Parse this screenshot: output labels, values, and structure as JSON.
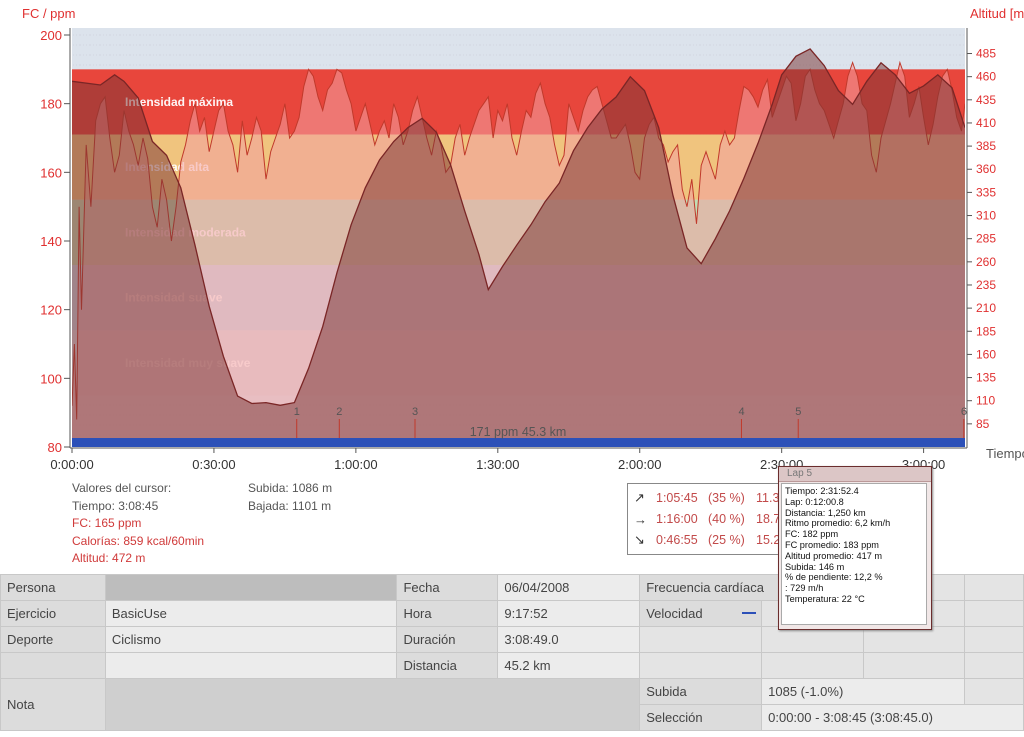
{
  "chart_data": {
    "type": "area",
    "left_axis_label": "FC / ppm",
    "right_axis_label": "Altitud [m]",
    "x_axis_label": "Tiempo",
    "ylim_fc": [
      80,
      200
    ],
    "yticks_fc": [
      "200",
      "180",
      "160",
      "140",
      "120",
      "100",
      "80"
    ],
    "ylim_alt": [
      60,
      505
    ],
    "yticks_alt": [
      "485",
      "460",
      "435",
      "410",
      "385",
      "360",
      "335",
      "310",
      "285",
      "260",
      "235",
      "210",
      "185",
      "160",
      "135",
      "110",
      "85"
    ],
    "xticks": [
      "0:00:00",
      "0:30:00",
      "1:00:00",
      "1:30:00",
      "2:00:00",
      "2:30:00",
      "3:00:00"
    ],
    "x_range_minutes": [
      0,
      188.75
    ],
    "zones": [
      {
        "name": "Intensidad máxima",
        "from": 171,
        "to": 190,
        "color": "#e8463c"
      },
      {
        "name": "Intensidad alta",
        "from": 152,
        "to": 171,
        "color": "#f0c47e"
      },
      {
        "name": "Intensidad moderada",
        "from": 133,
        "to": 152,
        "color": "#c2deb5"
      },
      {
        "name": "Intensidad suave",
        "from": 114,
        "to": 133,
        "color": "#c9d9e6"
      },
      {
        "name": "Intensidad muy suave",
        "from": 95,
        "to": 114,
        "color": "#dbdbe3"
      }
    ],
    "laps": [
      "1",
      "2",
      "3",
      "4",
      "5",
      "6"
    ],
    "lap_times_min": [
      47.5,
      56.5,
      72.5,
      141.5,
      153.5,
      188.5
    ],
    "bottom_label": "171 ppm 45.3 km",
    "altitude_series": {
      "name": "Altitud",
      "t": [
        0,
        3,
        6,
        9,
        11,
        14,
        17,
        20,
        23,
        26,
        29,
        32,
        35,
        38,
        41,
        44,
        47,
        50,
        53,
        56,
        59,
        62,
        65,
        68,
        71,
        74,
        77,
        80,
        83,
        86,
        88,
        91,
        94,
        97,
        100,
        103,
        106,
        109,
        112,
        115,
        118,
        121,
        124,
        127,
        130,
        133,
        136,
        139,
        142,
        145,
        148,
        150,
        153,
        156,
        159,
        162,
        165,
        168,
        171,
        174,
        177,
        180,
        183,
        186,
        188.75
      ],
      "values": [
        455,
        453,
        451,
        462,
        455,
        437,
        390,
        375,
        340,
        278,
        212,
        158,
        115,
        107,
        108,
        105,
        108,
        145,
        190,
        248,
        300,
        340,
        370,
        390,
        405,
        415,
        400,
        365,
        315,
        268,
        230,
        255,
        278,
        300,
        325,
        345,
        380,
        405,
        425,
        438,
        460,
        445,
        405,
        332,
        275,
        258,
        285,
        315,
        350,
        388,
        430,
        462,
        482,
        490,
        472,
        445,
        430,
        455,
        475,
        462,
        442,
        450,
        462,
        448,
        405
      ]
    },
    "heart_rate_series": {
      "name": "FC",
      "t": [
        0,
        0.5,
        1,
        1.5,
        2,
        3,
        4,
        5,
        6,
        7,
        8,
        9,
        10,
        11,
        12,
        13,
        14,
        15,
        16,
        17,
        18,
        19,
        20,
        21,
        22,
        23,
        24,
        25,
        26,
        27,
        28,
        29,
        30,
        31,
        32,
        33,
        34,
        35,
        36,
        37,
        38,
        39,
        40,
        41,
        42,
        43,
        44,
        45,
        46,
        47,
        48,
        49,
        50,
        51,
        52,
        53,
        54,
        55,
        56,
        57,
        58,
        59,
        60,
        61,
        62,
        63,
        64,
        65,
        66,
        67,
        68,
        69,
        70,
        71,
        72,
        73,
        74,
        75,
        76,
        77,
        78,
        79,
        80,
        81,
        82,
        83,
        84,
        85,
        86,
        87,
        88,
        89,
        90,
        91,
        92,
        93,
        94,
        95,
        96,
        97,
        98,
        99,
        100,
        101,
        102,
        103,
        104,
        105,
        106,
        107,
        108,
        109,
        110,
        111,
        112,
        113,
        114,
        115,
        116,
        117,
        118,
        119,
        120,
        121,
        122,
        123,
        124,
        125,
        126,
        127,
        128,
        129,
        130,
        131,
        132,
        133,
        134,
        135,
        136,
        137,
        138,
        139,
        140,
        141,
        142,
        143,
        144,
        145,
        146,
        147,
        148,
        149,
        150,
        151,
        152,
        153,
        154,
        155,
        156,
        157,
        158,
        159,
        160,
        161,
        162,
        163,
        164,
        165,
        166,
        167,
        168,
        169,
        170,
        171,
        172,
        173,
        174,
        175,
        176,
        177,
        178,
        179,
        180,
        181,
        182,
        183,
        184,
        185,
        186,
        187,
        188,
        188.75
      ],
      "values": [
        92,
        110,
        88,
        150,
        120,
        168,
        150,
        175,
        180,
        182,
        170,
        160,
        165,
        178,
        172,
        168,
        162,
        170,
        164,
        150,
        144,
        158,
        152,
        140,
        150,
        163,
        168,
        175,
        180,
        172,
        176,
        166,
        172,
        178,
        180,
        172,
        168,
        160,
        175,
        165,
        170,
        176,
        172,
        158,
        166,
        170,
        174,
        180,
        170,
        172,
        176,
        185,
        190,
        188,
        182,
        178,
        184,
        186,
        190,
        189,
        184,
        180,
        172,
        176,
        180,
        174,
        168,
        172,
        175,
        170,
        180,
        176,
        168,
        172,
        178,
        182,
        176,
        170,
        165,
        172,
        168,
        160,
        162,
        170,
        174,
        165,
        170,
        174,
        178,
        180,
        182,
        170,
        178,
        175,
        180,
        170,
        165,
        172,
        178,
        176,
        183,
        186,
        180,
        176,
        168,
        162,
        165,
        180,
        176,
        172,
        178,
        182,
        184,
        185,
        180,
        175,
        170,
        170,
        172,
        174,
        168,
        160,
        158,
        170,
        174,
        176,
        170,
        168,
        163,
        166,
        168,
        155,
        150,
        158,
        145,
        162,
        166,
        162,
        158,
        168,
        172,
        168,
        170,
        178,
        185,
        184,
        182,
        179,
        184,
        187,
        176,
        180,
        184,
        188,
        186,
        175,
        180,
        188,
        190,
        184,
        180,
        178,
        174,
        170,
        175,
        180,
        188,
        192,
        188,
        180,
        178,
        165,
        160,
        170,
        175,
        180,
        186,
        192,
        188,
        176,
        180,
        185,
        176,
        168,
        174,
        182,
        188,
        190,
        184,
        176,
        172,
        180,
        165
      ]
    }
  },
  "cursor": {
    "heading": "Valores del cursor:",
    "time": "Tiempo: 3:08:45",
    "fc": "FC: 165 ppm",
    "calories": "Calorías: 859 kcal/60min",
    "altitude": "Altitud: 472 m",
    "ascent": "Subida: 1086 m",
    "descent": "Bajada: 1101 m"
  },
  "slope_stats": [
    {
      "arrow": "↗",
      "time": "1:05:45",
      "percent": "(35 %)",
      "speed": "11.3"
    },
    {
      "arrow": "→",
      "time": "1:16:00",
      "percent": "(40 %)",
      "speed": "18.7"
    },
    {
      "arrow": "↘",
      "time": "0:46:55",
      "percent": "(25 %)",
      "speed": "15.2"
    }
  ],
  "tooltip": {
    "title": "Lap 5",
    "lines": [
      "Tiempo: 2:31:52.4",
      "Lap: 0:12:00.8",
      "Distancia: 1,250 km",
      "Ritmo promedio: 6,2 km/h",
      "FC: 182 ppm",
      "FC promedio: 183 ppm",
      "Altitud promedio: 417 m",
      "Subida: 146 m",
      "% de pendiente: 12,2 %",
      ": 729 m/h",
      "Temperatura: 22 °C"
    ]
  },
  "info": {
    "persona_label": "Persona",
    "persona_value": "",
    "ejercicio_label": "Ejercicio",
    "ejercicio_value": "BasicUse",
    "deporte_label": "Deporte",
    "deporte_value": "Ciclismo",
    "nota_label": "Nota",
    "nota_value": "",
    "fecha_label": "Fecha",
    "fecha_value": "06/04/2008",
    "hora_label": "Hora",
    "hora_value": "9:17:52",
    "duracion_label": "Duración",
    "duracion_value": "3:08:49.0",
    "distancia_label": "Distancia",
    "distancia_value": "45.2 km",
    "fc_label": "Frecuencia cardíaca",
    "velocidad_label": "Velocidad",
    "subida_label": "Subida",
    "subida_value": "1085 (-1.0%)",
    "seleccion_label": "Selección",
    "seleccion_value": "0:00:00 - 3:08:45 (3:08:45.0)"
  },
  "colors": {
    "fc_line": "#c0392b",
    "altitude_fill": "#8e4a4a",
    "axis_text": "#e03030",
    "bottom_bar": "#2c50b8"
  }
}
